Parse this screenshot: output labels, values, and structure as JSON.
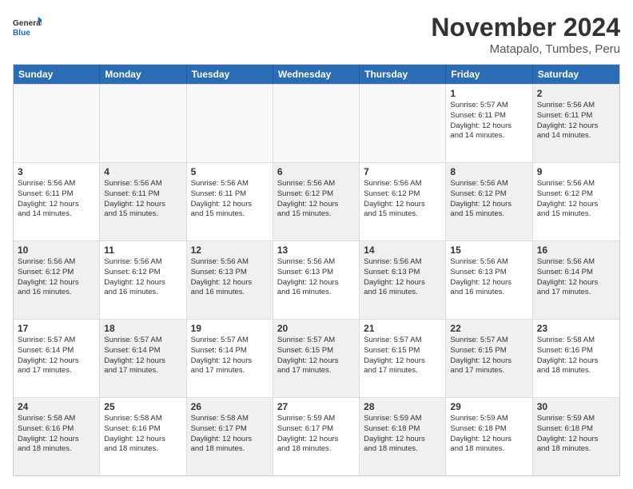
{
  "header": {
    "logo_general": "General",
    "logo_blue": "Blue",
    "month_title": "November 2024",
    "subtitle": "Matapalo, Tumbes, Peru"
  },
  "weekdays": [
    "Sunday",
    "Monday",
    "Tuesday",
    "Wednesday",
    "Thursday",
    "Friday",
    "Saturday"
  ],
  "rows": [
    [
      {
        "day": "",
        "info": "",
        "shaded": true
      },
      {
        "day": "",
        "info": "",
        "shaded": true
      },
      {
        "day": "",
        "info": "",
        "shaded": true
      },
      {
        "day": "",
        "info": "",
        "shaded": true
      },
      {
        "day": "",
        "info": "",
        "shaded": true
      },
      {
        "day": "1",
        "info": "Sunrise: 5:57 AM\nSunset: 6:11 PM\nDaylight: 12 hours\nand 14 minutes.",
        "shaded": false
      },
      {
        "day": "2",
        "info": "Sunrise: 5:56 AM\nSunset: 6:11 PM\nDaylight: 12 hours\nand 14 minutes.",
        "shaded": true
      }
    ],
    [
      {
        "day": "3",
        "info": "Sunrise: 5:56 AM\nSunset: 6:11 PM\nDaylight: 12 hours\nand 14 minutes.",
        "shaded": false
      },
      {
        "day": "4",
        "info": "Sunrise: 5:56 AM\nSunset: 6:11 PM\nDaylight: 12 hours\nand 15 minutes.",
        "shaded": true
      },
      {
        "day": "5",
        "info": "Sunrise: 5:56 AM\nSunset: 6:11 PM\nDaylight: 12 hours\nand 15 minutes.",
        "shaded": false
      },
      {
        "day": "6",
        "info": "Sunrise: 5:56 AM\nSunset: 6:12 PM\nDaylight: 12 hours\nand 15 minutes.",
        "shaded": true
      },
      {
        "day": "7",
        "info": "Sunrise: 5:56 AM\nSunset: 6:12 PM\nDaylight: 12 hours\nand 15 minutes.",
        "shaded": false
      },
      {
        "day": "8",
        "info": "Sunrise: 5:56 AM\nSunset: 6:12 PM\nDaylight: 12 hours\nand 15 minutes.",
        "shaded": true
      },
      {
        "day": "9",
        "info": "Sunrise: 5:56 AM\nSunset: 6:12 PM\nDaylight: 12 hours\nand 15 minutes.",
        "shaded": false
      }
    ],
    [
      {
        "day": "10",
        "info": "Sunrise: 5:56 AM\nSunset: 6:12 PM\nDaylight: 12 hours\nand 16 minutes.",
        "shaded": true
      },
      {
        "day": "11",
        "info": "Sunrise: 5:56 AM\nSunset: 6:12 PM\nDaylight: 12 hours\nand 16 minutes.",
        "shaded": false
      },
      {
        "day": "12",
        "info": "Sunrise: 5:56 AM\nSunset: 6:13 PM\nDaylight: 12 hours\nand 16 minutes.",
        "shaded": true
      },
      {
        "day": "13",
        "info": "Sunrise: 5:56 AM\nSunset: 6:13 PM\nDaylight: 12 hours\nand 16 minutes.",
        "shaded": false
      },
      {
        "day": "14",
        "info": "Sunrise: 5:56 AM\nSunset: 6:13 PM\nDaylight: 12 hours\nand 16 minutes.",
        "shaded": true
      },
      {
        "day": "15",
        "info": "Sunrise: 5:56 AM\nSunset: 6:13 PM\nDaylight: 12 hours\nand 16 minutes.",
        "shaded": false
      },
      {
        "day": "16",
        "info": "Sunrise: 5:56 AM\nSunset: 6:14 PM\nDaylight: 12 hours\nand 17 minutes.",
        "shaded": true
      }
    ],
    [
      {
        "day": "17",
        "info": "Sunrise: 5:57 AM\nSunset: 6:14 PM\nDaylight: 12 hours\nand 17 minutes.",
        "shaded": false
      },
      {
        "day": "18",
        "info": "Sunrise: 5:57 AM\nSunset: 6:14 PM\nDaylight: 12 hours\nand 17 minutes.",
        "shaded": true
      },
      {
        "day": "19",
        "info": "Sunrise: 5:57 AM\nSunset: 6:14 PM\nDaylight: 12 hours\nand 17 minutes.",
        "shaded": false
      },
      {
        "day": "20",
        "info": "Sunrise: 5:57 AM\nSunset: 6:15 PM\nDaylight: 12 hours\nand 17 minutes.",
        "shaded": true
      },
      {
        "day": "21",
        "info": "Sunrise: 5:57 AM\nSunset: 6:15 PM\nDaylight: 12 hours\nand 17 minutes.",
        "shaded": false
      },
      {
        "day": "22",
        "info": "Sunrise: 5:57 AM\nSunset: 6:15 PM\nDaylight: 12 hours\nand 17 minutes.",
        "shaded": true
      },
      {
        "day": "23",
        "info": "Sunrise: 5:58 AM\nSunset: 6:16 PM\nDaylight: 12 hours\nand 18 minutes.",
        "shaded": false
      }
    ],
    [
      {
        "day": "24",
        "info": "Sunrise: 5:58 AM\nSunset: 6:16 PM\nDaylight: 12 hours\nand 18 minutes.",
        "shaded": true
      },
      {
        "day": "25",
        "info": "Sunrise: 5:58 AM\nSunset: 6:16 PM\nDaylight: 12 hours\nand 18 minutes.",
        "shaded": false
      },
      {
        "day": "26",
        "info": "Sunrise: 5:58 AM\nSunset: 6:17 PM\nDaylight: 12 hours\nand 18 minutes.",
        "shaded": true
      },
      {
        "day": "27",
        "info": "Sunrise: 5:59 AM\nSunset: 6:17 PM\nDaylight: 12 hours\nand 18 minutes.",
        "shaded": false
      },
      {
        "day": "28",
        "info": "Sunrise: 5:59 AM\nSunset: 6:18 PM\nDaylight: 12 hours\nand 18 minutes.",
        "shaded": true
      },
      {
        "day": "29",
        "info": "Sunrise: 5:59 AM\nSunset: 6:18 PM\nDaylight: 12 hours\nand 18 minutes.",
        "shaded": false
      },
      {
        "day": "30",
        "info": "Sunrise: 5:59 AM\nSunset: 6:18 PM\nDaylight: 12 hours\nand 18 minutes.",
        "shaded": true
      }
    ]
  ]
}
